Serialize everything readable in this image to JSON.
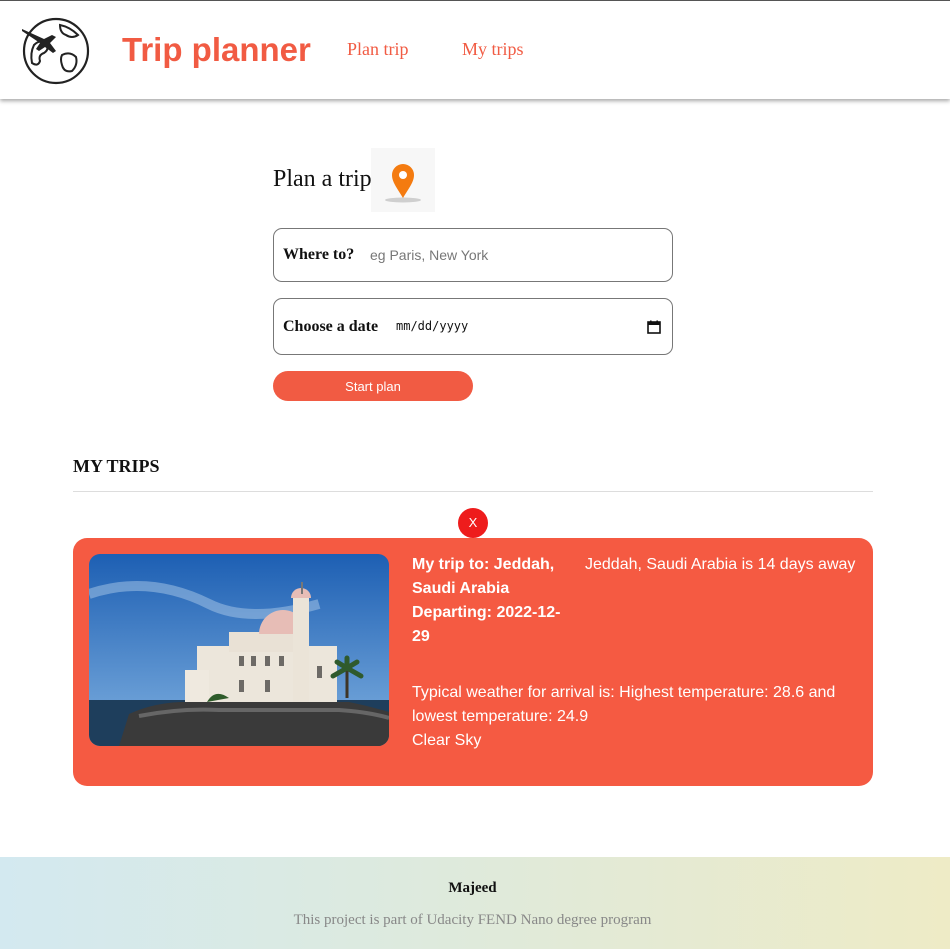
{
  "header": {
    "title": "Trip planner",
    "logo_icon": "globe-airplane-icon",
    "nav": [
      {
        "label": "Plan trip"
      },
      {
        "label": "My trips"
      }
    ]
  },
  "plan": {
    "heading": "Plan a trip",
    "heading_icon": "map-pin-icon",
    "destination_label": "Where to?",
    "destination_placeholder": "eg Paris, New York",
    "destination_value": "",
    "date_label": "Choose a date",
    "date_value": "mm/dd/yyyy",
    "submit_label": "Start plan"
  },
  "trips": {
    "heading": "MY TRIPS",
    "remove_label": "X",
    "items": [
      {
        "title_line": "My trip to: Jeddah, Saudi Arabia",
        "departing_line": "Departing: 2022-12-29",
        "countdown": "Jeddah, Saudi Arabia is 14 days away",
        "weather_line": "Typical weather for arrival is: Highest temperature: 28.6 and lowest temperature: 24.9",
        "sky": "Clear Sky",
        "image_icon": "mosque-photo"
      }
    ]
  },
  "footer": {
    "name": "Majeed",
    "note": "This project is part of Udacity FEND Nano degree program"
  },
  "colors": {
    "accent": "#f15b43",
    "card": "#f55a42",
    "remove": "#ee1c1c"
  }
}
